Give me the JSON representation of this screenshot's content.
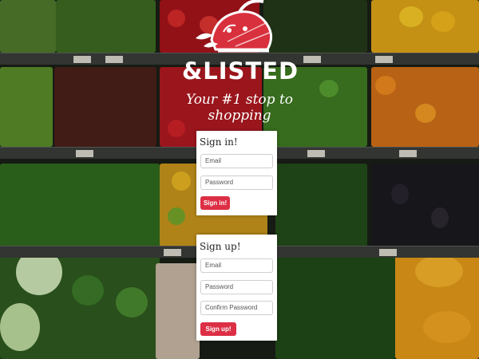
{
  "brand": {
    "name": "&LISTED",
    "tagline": "Your #1 stop to shopping"
  },
  "sign_in": {
    "title": "Sign in!",
    "email_placeholder": "Email",
    "password_placeholder": "Password",
    "button": "Sign in!"
  },
  "sign_up": {
    "title": "Sign up!",
    "email_placeholder": "Email",
    "password_placeholder": "Password",
    "confirm_placeholder": "Confirm Password",
    "button": "Sign up!"
  },
  "colors": {
    "accent": "#dc2f45",
    "logo_red": "#d9303d"
  }
}
